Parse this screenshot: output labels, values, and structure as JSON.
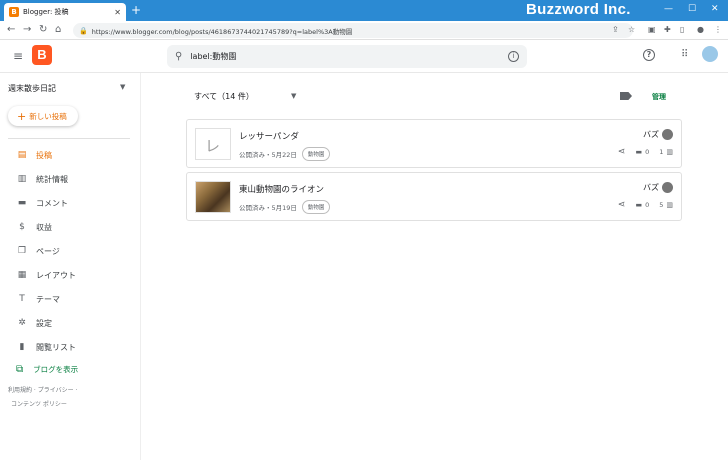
{
  "browser": {
    "tab_title": "Blogger: 投稿",
    "tab_favicon": "B",
    "new_tab": "+",
    "brand_overlay": "Buzzword Inc.",
    "url": "https://www.blogger.com/blog/posts/4618673744021745789?q=label%3A動物園"
  },
  "header": {
    "logo_letter": "B",
    "search_value": "label:動物園",
    "help_glyph": "?"
  },
  "sidebar": {
    "blog_name": "週末散歩日記",
    "new_post_label": "新しい投稿",
    "items": [
      {
        "label": "投稿",
        "icon": "posts-icon",
        "glyph": "▤",
        "active": true
      },
      {
        "label": "統計情報",
        "icon": "stats-icon",
        "glyph": "▥",
        "active": false
      },
      {
        "label": "コメント",
        "icon": "comment-icon",
        "glyph": "▬",
        "active": false
      },
      {
        "label": "収益",
        "icon": "dollar-icon",
        "glyph": "$",
        "active": false
      },
      {
        "label": "ページ",
        "icon": "pages-icon",
        "glyph": "❐",
        "active": false
      },
      {
        "label": "レイアウト",
        "icon": "layout-icon",
        "glyph": "▦",
        "active": false
      },
      {
        "label": "テーマ",
        "icon": "theme-icon",
        "glyph": "T",
        "active": false
      },
      {
        "label": "設定",
        "icon": "gear-icon",
        "glyph": "✲",
        "active": false
      },
      {
        "label": "閲覧リスト",
        "icon": "bookmark-icon",
        "glyph": "▮",
        "active": false
      }
    ],
    "view_blog_label": "ブログを表示",
    "footer_line1": "利用規約 · プライバシー ·",
    "footer_line2": "コンテンツ ポリシー"
  },
  "main": {
    "filter_label": "すべて（14 件）",
    "manage_label": "管理",
    "posts": [
      {
        "title": "レッサーパンダ",
        "thumb_glyph": "レ",
        "status": "公開済み・5月22日",
        "label": "動物園",
        "author": "バズ",
        "comments": "0",
        "views": "1"
      },
      {
        "title": "東山動物園のライオン",
        "status": "公開済み・5月19日",
        "label": "動物園",
        "author": "バズ",
        "comments": "0",
        "views": "5"
      }
    ]
  },
  "colors": {
    "accent": "#e8710a",
    "green": "#0b8043",
    "titlebar": "#2b8ad3"
  }
}
